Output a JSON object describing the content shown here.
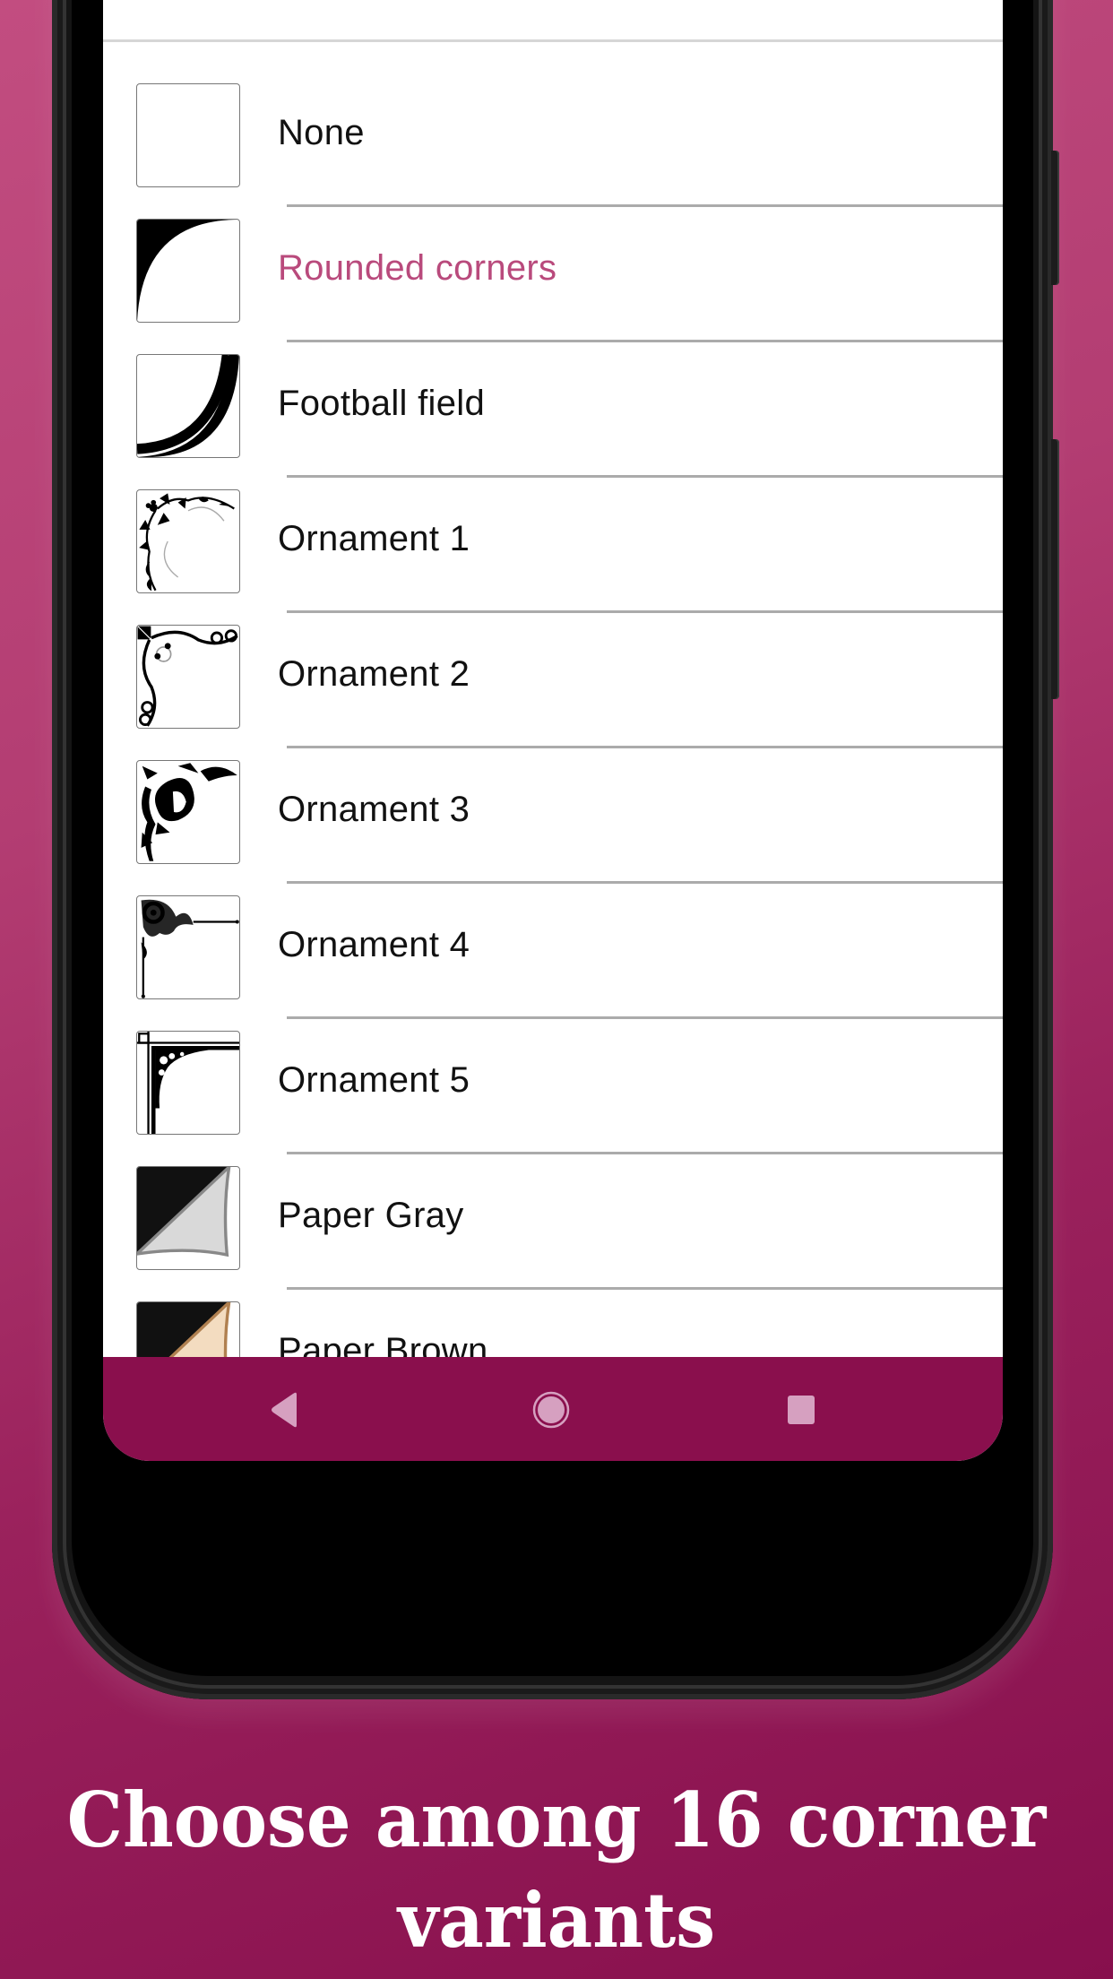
{
  "app": {
    "corner_list": {
      "items": [
        {
          "label": "None",
          "icon": "corner-none-icon",
          "selected": false
        },
        {
          "label": "Rounded corners",
          "icon": "corner-rounded-icon",
          "selected": true
        },
        {
          "label": "Football field",
          "icon": "corner-football-field-icon",
          "selected": false
        },
        {
          "label": "Ornament 1",
          "icon": "corner-ornament-1-icon",
          "selected": false
        },
        {
          "label": "Ornament 2",
          "icon": "corner-ornament-2-icon",
          "selected": false
        },
        {
          "label": "Ornament 3",
          "icon": "corner-ornament-3-icon",
          "selected": false
        },
        {
          "label": "Ornament 4",
          "icon": "corner-ornament-4-icon",
          "selected": false
        },
        {
          "label": "Ornament 5",
          "icon": "corner-ornament-5-icon",
          "selected": false
        },
        {
          "label": "Paper Gray",
          "icon": "corner-paper-gray-icon",
          "selected": false
        },
        {
          "label": "Paper Brown",
          "icon": "corner-paper-brown-icon",
          "selected": false
        }
      ]
    },
    "navbar": {
      "back": "back-icon",
      "home": "home-icon",
      "recents": "recents-icon"
    }
  },
  "colors": {
    "accent_selected": "#b94a7c",
    "navbar": "#8a0f4d",
    "nav_icon": "#d6a0c0",
    "background_top": "#c24d80",
    "background_bottom": "#870f4d"
  },
  "caption": {
    "line1": "Choose among 16 corner",
    "line2": "variants"
  }
}
